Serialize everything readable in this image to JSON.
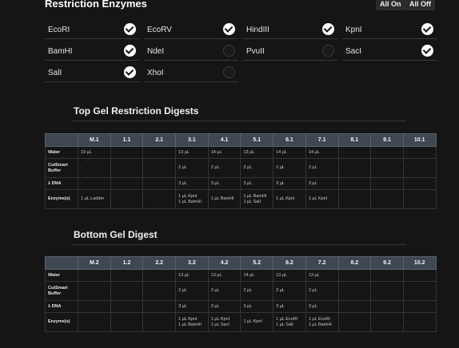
{
  "header": {
    "title": "Restriction Enzymes",
    "all_on": "All On",
    "all_off": "All Off"
  },
  "enzymes": [
    {
      "label": "EcoRI",
      "checked": true
    },
    {
      "label": "EcoRV",
      "checked": true
    },
    {
      "label": "HindIII",
      "checked": true
    },
    {
      "label": "KpnI",
      "checked": true
    },
    {
      "label": "BamHI",
      "checked": true
    },
    {
      "label": "NdeI",
      "checked": false
    },
    {
      "label": "PvuII",
      "checked": false
    },
    {
      "label": "SacI",
      "checked": true
    },
    {
      "label": "SalI",
      "checked": true
    },
    {
      "label": "XhoI",
      "checked": false
    }
  ],
  "top_gel": {
    "title": "Top Gel Restriction Digests",
    "columns": [
      "",
      "M.1",
      "1.1",
      "2.1",
      "3.1",
      "4.1",
      "5.1",
      "6.1",
      "7.1",
      "8.1",
      "9.1",
      "10.1"
    ],
    "rows": [
      {
        "label": "Water",
        "cells": [
          "19 µL",
          "-",
          "-",
          "13 µL",
          "14 µL",
          "13 µL",
          "14 µL",
          "14 µL",
          "-",
          "-",
          "-"
        ]
      },
      {
        "label": "CutSmart Buffer",
        "cells": [
          "-",
          "-",
          "-",
          "2 µL",
          "2 µL",
          "2 µL",
          "2 µL",
          "2 µL",
          "-",
          "-",
          "-"
        ]
      },
      {
        "label": "λ DNA",
        "cells": [
          "-",
          "-",
          "-",
          "3 µL",
          "3 µL",
          "3 µL",
          "3 µL",
          "3 µL",
          "-",
          "-",
          "-"
        ]
      },
      {
        "label": "Enzyme(s)",
        "cells": [
          "1 µL Ladder",
          "-",
          "-",
          "1 µL KpnI\n1 µL BamHI",
          "1 µL BamHI",
          "1 µL BamHI\n1 µL SalI",
          "1 µL KpnI",
          "1 µL KpnI",
          "-",
          "-",
          "-"
        ]
      }
    ]
  },
  "bottom_gel": {
    "title": "Bottom Gel Digest",
    "columns": [
      "",
      "M.2",
      "1.2",
      "2.2",
      "3.2",
      "4.2",
      "5.2",
      "6.2",
      "7.2",
      "8.2",
      "9.2",
      "10.2"
    ],
    "rows": [
      {
        "label": "Water",
        "cells": [
          "-",
          "-",
          "-",
          "13 µL",
          "13 µL",
          "14 µL",
          "13 µL",
          "13 µL",
          "-",
          "-",
          "-"
        ]
      },
      {
        "label": "CutSmart Buffer",
        "cells": [
          "-",
          "-",
          "-",
          "2 µL",
          "2 µL",
          "2 µL",
          "2 µL",
          "2 µL",
          "-",
          "-",
          "-"
        ]
      },
      {
        "label": "λ DNA",
        "cells": [
          "-",
          "-",
          "-",
          "3 µL",
          "3 µL",
          "3 µL",
          "3 µL",
          "3 µL",
          "-",
          "-",
          "-"
        ]
      },
      {
        "label": "Enzyme(s)",
        "cells": [
          "-",
          "-",
          "-",
          "1 µL KpnI\n1 µL BamHI",
          "1 µL KpnI\n1 µL SacI",
          "1 µL KpnI",
          "1 µL EcoRI\n1 µL SalI",
          "1 µL EcoRI\n1 µL BamHI",
          "-",
          "-",
          "-"
        ]
      }
    ]
  }
}
